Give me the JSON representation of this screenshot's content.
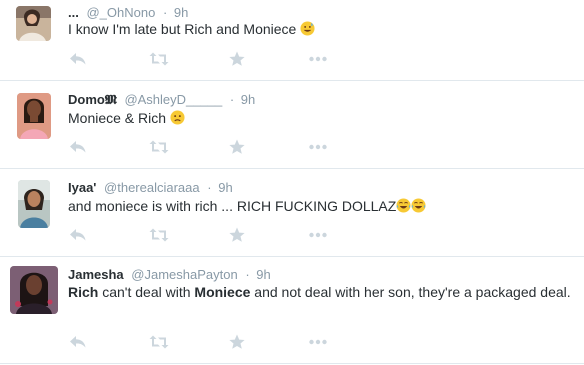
{
  "colors": {
    "meta": "#8899a6",
    "icon": "#ccd6dd",
    "divider": "#e1e8ed",
    "text": "#292f33"
  },
  "tweets": [
    {
      "fullname": "...",
      "username": "@_OhNono",
      "dot": "·",
      "time": "9h",
      "text": "I know I'm late but Rich and Moniece",
      "emoji": "sweat-smile"
    },
    {
      "fullname": "Domo𝕸",
      "username": "@AshleyD_____",
      "dot": "·",
      "time": "9h",
      "text": "Moniece & Rich",
      "emoji": "confused"
    },
    {
      "fullname": "Iyaa'",
      "username": "@therealciaraaa",
      "dot": "·",
      "time": "9h",
      "text": "and moniece is with rich ... RICH FUCKING DOLLAZ",
      "emoji": "joy-joy"
    },
    {
      "fullname": "Jamesha",
      "username": "@JameshaPayton",
      "dot": "·",
      "time": "9h",
      "text_parts": [
        "Rich",
        " can't deal with ",
        "Moniece",
        " and not deal with her son, they're a packaged deal."
      ]
    }
  ],
  "actions": [
    "reply-icon",
    "retweet-icon",
    "favorite-icon",
    "more-icon"
  ]
}
